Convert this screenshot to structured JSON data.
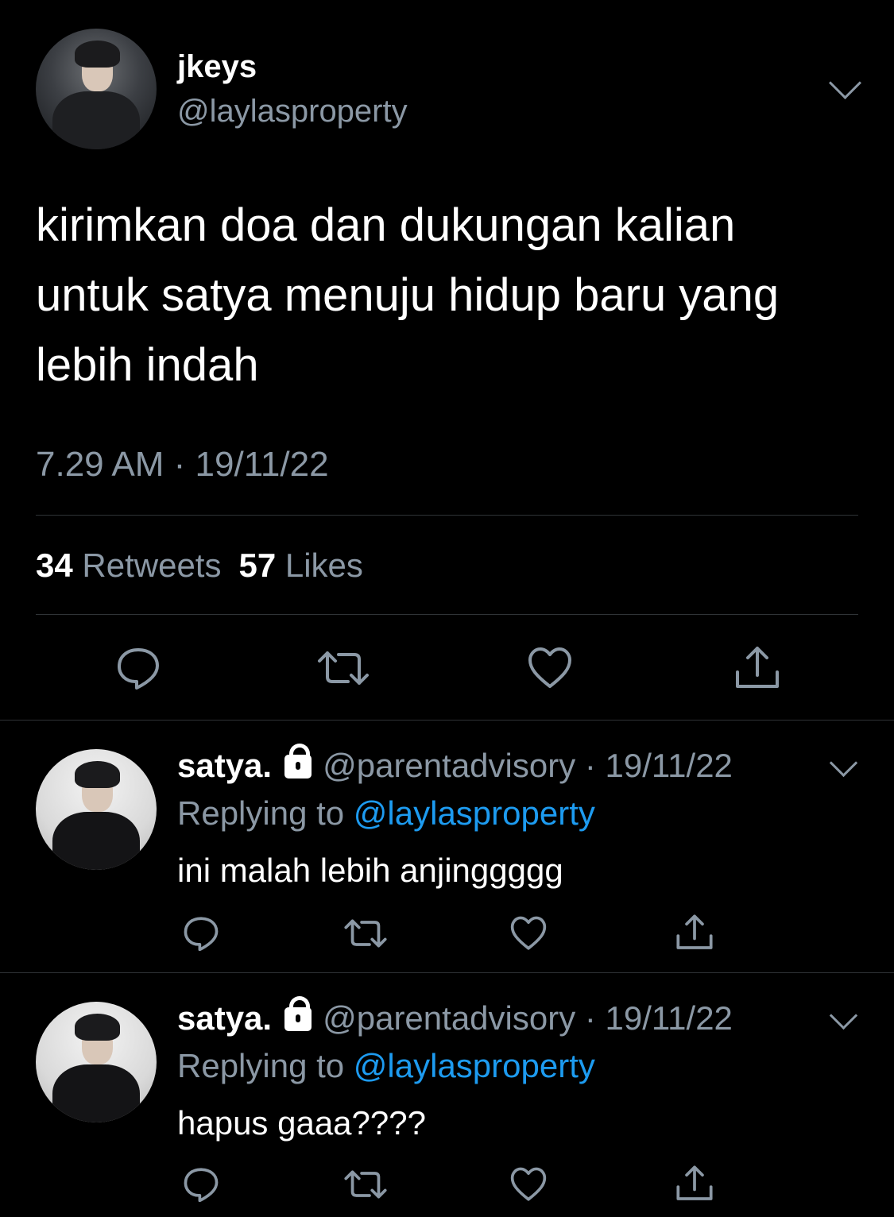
{
  "main_tweet": {
    "display_name": "jkeys",
    "handle": "@laylasproperty",
    "text_lines": [
      "kirimkan doa dan dukungan kalian",
      "untuk satya menuju hidup baru yang",
      "lebih indah"
    ],
    "timestamp": "7.29 AM · 19/11/22",
    "retweets_count": "34",
    "retweets_label": "Retweets",
    "likes_count": "57",
    "likes_label": "Likes"
  },
  "replies": [
    {
      "display_name": "satya.",
      "handle_date": "@parentadvisory · 19/11/22",
      "replying_prefix": "Replying to",
      "replying_to": "@laylasproperty",
      "text": "ini malah lebih anjinggggg"
    },
    {
      "display_name": "satya.",
      "handle_date": "@parentadvisory · 19/11/22",
      "replying_prefix": "Replying to",
      "replying_to": "@laylasproperty",
      "text": "hapus gaaa????"
    }
  ],
  "icons": {
    "reply": "reply-icon",
    "retweet": "retweet-icon",
    "like": "heart-icon",
    "share": "share-icon",
    "more": "chevron-down-icon",
    "protected": "lock-icon"
  },
  "colors": {
    "background": "#000000",
    "primary_text": "#ffffff",
    "secondary_text": "#8b98a5",
    "link": "#1d9bf0",
    "divider": "#2f3336"
  }
}
